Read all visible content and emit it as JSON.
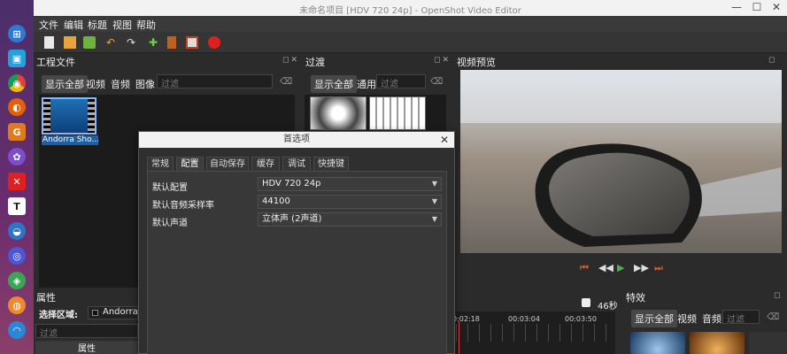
{
  "window": {
    "title": "未命名项目 [HDV 720 24p] - OpenShot Video Editor",
    "minimize_glyph": "—",
    "maximize_glyph": "☐",
    "close_glyph": "✕"
  },
  "menu": [
    "文件",
    "编辑",
    "标题",
    "视图",
    "帮助"
  ],
  "dock_icons": [
    {
      "name": "apps-icon",
      "glyph": "⊞",
      "color": "#2d7ad6"
    },
    {
      "name": "store-icon",
      "glyph": "▣",
      "color": "#26a0d8"
    },
    {
      "name": "chrome-icon",
      "glyph": "◉",
      "color": "#2e9e44"
    },
    {
      "name": "firefox-icon",
      "glyph": "◐",
      "color": "#e66000"
    },
    {
      "name": "gimp-icon",
      "glyph": "G",
      "color": "#e07b1b"
    },
    {
      "name": "settings-icon",
      "glyph": "✿",
      "color": "#7c4dcc"
    },
    {
      "name": "xmind-icon",
      "glyph": "✕",
      "color": "#e02020"
    },
    {
      "name": "typora-icon",
      "glyph": "T",
      "color": "#ffffff"
    },
    {
      "name": "terminal-icon",
      "glyph": "◒",
      "color": "#2b74c7"
    },
    {
      "name": "music-icon",
      "glyph": "◎",
      "color": "#4b57d6"
    },
    {
      "name": "maps-icon",
      "glyph": "◈",
      "color": "#3aa655"
    },
    {
      "name": "chat-icon",
      "glyph": "◍",
      "color": "#ef8a2b"
    },
    {
      "name": "wifi-icon",
      "glyph": "◠",
      "color": "#2a86d8"
    }
  ],
  "panels": {
    "project_files": {
      "title": "工程文件",
      "filters": [
        "显示全部",
        "视频",
        "音频",
        "图像"
      ],
      "placeholder": "过滤",
      "clip_label": "Andorra Sho..."
    },
    "transitions": {
      "title": "过渡",
      "filters": [
        "显示全部",
        "通用"
      ],
      "placeholder": "过滤"
    },
    "preview": {
      "title": "视频预览"
    },
    "properties": {
      "title": "属性",
      "selection_label": "选择区域:",
      "selection_value": "Andorra Sh",
      "placeholder": "过滤",
      "column_header": "属性"
    },
    "timeline": {
      "duration": "46秒",
      "ticks": [
        "0:02:18",
        "00:03:04",
        "00:03:50"
      ]
    },
    "effects": {
      "title": "特效",
      "filters": [
        "显示全部",
        "视频",
        "音频"
      ],
      "placeholder": "过滤"
    }
  },
  "dialog": {
    "title": "首选项",
    "tabs": [
      "常规",
      "配置",
      "自动保存",
      "缓存",
      "调试",
      "快捷键"
    ],
    "active_tab": 1,
    "fields": [
      {
        "label": "默认配置",
        "value": "HDV 720 24p"
      },
      {
        "label": "默认音频采样率",
        "value": "44100"
      },
      {
        "label": "默认声道",
        "value": "立体声 (2声道)"
      }
    ]
  },
  "colors": {
    "accent": "#2f6fb7",
    "play": "#4caf50",
    "transport": "#e0632a",
    "record": "#e02020"
  }
}
